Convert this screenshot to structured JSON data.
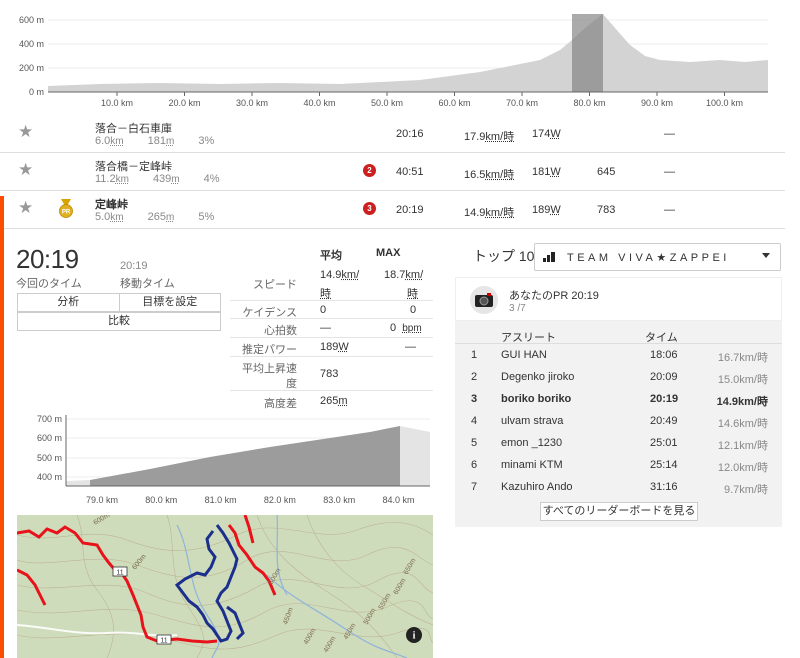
{
  "top_chart": {
    "y_ticks": [
      "600 m",
      "400 m",
      "200 m",
      "0 m"
    ],
    "x_ticks": [
      "10.0 km",
      "20.0 km",
      "30.0 km",
      "40.0 km",
      "50.0 km",
      "60.0 km",
      "70.0 km",
      "80.0 km",
      "90.0 km",
      "100.0 km"
    ]
  },
  "segments": [
    {
      "name": "落合－白石車庫",
      "distance": "6.0",
      "distance_unit": "km",
      "elev": "181",
      "elev_unit": "m",
      "grade": "3%",
      "badge": "",
      "time": "20:16",
      "speed": "17.9",
      "speed_unit": "km/時",
      "power": "174",
      "power_unit": "W",
      "extra": "",
      "dash": "—"
    },
    {
      "name": "落合橋－定峰峠",
      "distance": "11.2",
      "distance_unit": "km",
      "elev": "439",
      "elev_unit": "m",
      "grade": "4%",
      "badge": "2",
      "time": "40:51",
      "speed": "16.5",
      "speed_unit": "km/時",
      "power": "181",
      "power_unit": "W",
      "extra": "645",
      "dash": "—"
    },
    {
      "name": "定峰峠",
      "distance": "5.0",
      "distance_unit": "km",
      "elev": "265",
      "elev_unit": "m",
      "grade": "5%",
      "badge": "3",
      "medal": "PR",
      "time": "20:19",
      "speed": "14.9",
      "speed_unit": "km/時",
      "power": "189",
      "power_unit": "W",
      "extra": "783",
      "dash": "—"
    }
  ],
  "pr": {
    "time": "20:19",
    "time_label": "今回のタイム",
    "moving_time": "20:19",
    "moving_label": "移動タイム",
    "btn_analysis": "分析",
    "btn_goal": "目標を設定",
    "btn_compare": "比較"
  },
  "stats": {
    "head_avg": "平均",
    "head_max": "MAX",
    "speed_label": "スピード",
    "speed_avg": "14.9",
    "speed_avg_unit": "km/",
    "speed_avg_unit2": "時",
    "speed_max": "18.7",
    "speed_max_unit": "km/",
    "speed_max_unit2": "時",
    "cadence_label": "ケイデンス",
    "cadence_avg": "0",
    "cadence_max": "0",
    "hr_label": "心拍数",
    "hr_avg": "—",
    "hr_max": "0",
    "hr_unit": "bpm",
    "power_label": "推定パワー",
    "power_avg": "189",
    "power_unit": "W",
    "power_max": "—",
    "vam_label1": "平均上昇速",
    "vam_label2": "度",
    "vam_val": "783",
    "elev_label": "高度差",
    "elev_val": "265",
    "elev_unit": "m"
  },
  "seg_chart": {
    "y_ticks": [
      "700 m",
      "600 m",
      "500 m",
      "400 m"
    ],
    "x_ticks": [
      "79.0 km",
      "80.0 km",
      "81.0 km",
      "82.0 km",
      "83.0 km",
      "84.0 km"
    ]
  },
  "map": {
    "road_labels": [
      "11",
      "11"
    ],
    "contour_labels": [
      "600m",
      "600m",
      "500m",
      "450m",
      "400m",
      "650m",
      "600m",
      "550m",
      "500m",
      "450m",
      "400m"
    ],
    "info_icon": "i"
  },
  "leaderboard": {
    "title": "トップ 10",
    "club": "TEAM VIVA★ZAPPEI",
    "pr_title": "あなたのPR 20:19",
    "pr_sub": "3 /7",
    "col_athlete": "アスリート",
    "col_time": "タイム",
    "rows": [
      {
        "rank": "1",
        "athlete": "GUI HAN",
        "time": "18:06",
        "speed": "16.7km/時"
      },
      {
        "rank": "2",
        "athlete": "Degenko jiroko",
        "time": "20:09",
        "speed": "15.0km/時"
      },
      {
        "rank": "3",
        "athlete": "boriko boriko",
        "time": "20:19",
        "speed": "14.9km/時",
        "me": true
      },
      {
        "rank": "4",
        "athlete": "ulvam strava",
        "time": "20:49",
        "speed": "14.6km/時"
      },
      {
        "rank": "5",
        "athlete": "emon _1230",
        "time": "25:01",
        "speed": "12.1km/時"
      },
      {
        "rank": "6",
        "athlete": "minami KTM",
        "time": "25:14",
        "speed": "12.0km/時"
      },
      {
        "rank": "7",
        "athlete": "Kazuhiro Ando",
        "time": "31:16",
        "speed": "9.7km/時"
      }
    ],
    "all_button": "すべてのリーダーボードを見る"
  },
  "colors": {
    "accent": "#fc4c02",
    "badge_red": "#cc1f1f",
    "route_red": "#e8121a",
    "segment_blue": "#1b2f8c"
  }
}
